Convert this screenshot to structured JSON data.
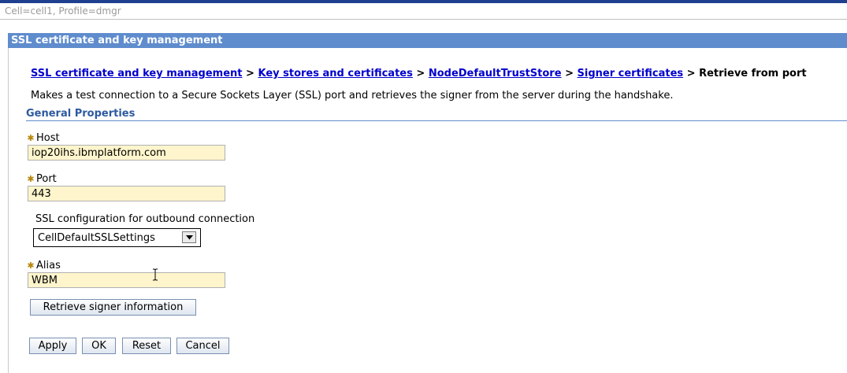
{
  "context": "Cell=cell1, Profile=dmgr",
  "panel_title": "SSL certificate and key management",
  "breadcrumb": {
    "items": [
      "SSL certificate and key management",
      "Key stores and certificates",
      "NodeDefaultTrustStore",
      "Signer certificates"
    ],
    "separator": ">",
    "current": "Retrieve from port"
  },
  "description": "Makes a test connection to a Secure Sockets Layer (SSL) port and retrieves the signer from the server during the handshake.",
  "section_header": "General Properties",
  "required_marker": "✱",
  "form": {
    "host": {
      "label": "Host",
      "value": "iop20ihs.ibmplatform.com"
    },
    "port": {
      "label": "Port",
      "value": "443"
    },
    "ssl_config": {
      "label": "SSL configuration for outbound connection",
      "selected": "CellDefaultSSLSettings"
    },
    "alias": {
      "label": "Alias",
      "value": "WBM"
    }
  },
  "retrieve_button": "Retrieve signer information",
  "actions": {
    "apply": "Apply",
    "ok": "OK",
    "reset": "Reset",
    "cancel": "Cancel"
  },
  "colors": {
    "title_bar": "#5f8ccd",
    "link": "#0000cc",
    "section_header": "#2c5aa0",
    "input_bg": "#fff5cc"
  }
}
